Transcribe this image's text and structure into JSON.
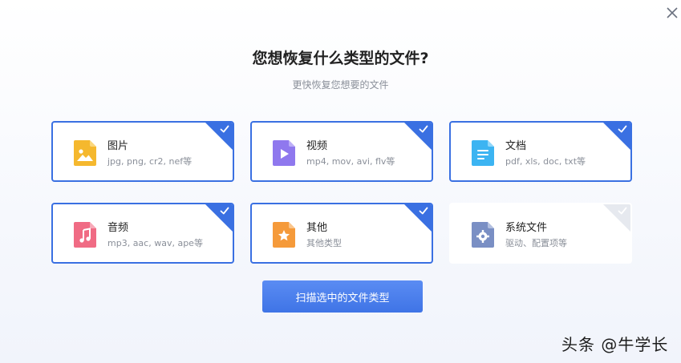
{
  "dialog": {
    "title": "您想恢复什么类型的文件?",
    "subtitle": "更快恢复您想要的文件",
    "scan_button": "扫描选中的文件类型"
  },
  "file_types": [
    {
      "name": "图片",
      "desc": "jpg, png, cr2, nef等",
      "icon": "image-icon",
      "selected": true,
      "color": "#f5b82e"
    },
    {
      "name": "视频",
      "desc": "mp4, mov, avi, flv等",
      "icon": "video-icon",
      "selected": true,
      "color": "#8f78ee"
    },
    {
      "name": "文档",
      "desc": "pdf, xls, doc, txt等",
      "icon": "document-icon",
      "selected": true,
      "color": "#3cb4f2"
    },
    {
      "name": "音频",
      "desc": "mp3, aac, wav, ape等",
      "icon": "audio-icon",
      "selected": true,
      "color": "#f06b84"
    },
    {
      "name": "其他",
      "desc": "其他类型",
      "icon": "other-icon",
      "selected": true,
      "color": "#f59a3a"
    },
    {
      "name": "系统文件",
      "desc": "驱动、配置项等",
      "icon": "system-file-icon",
      "selected": false,
      "color": "#7a8fc4"
    }
  ],
  "watermark": "头条 @牛学长"
}
